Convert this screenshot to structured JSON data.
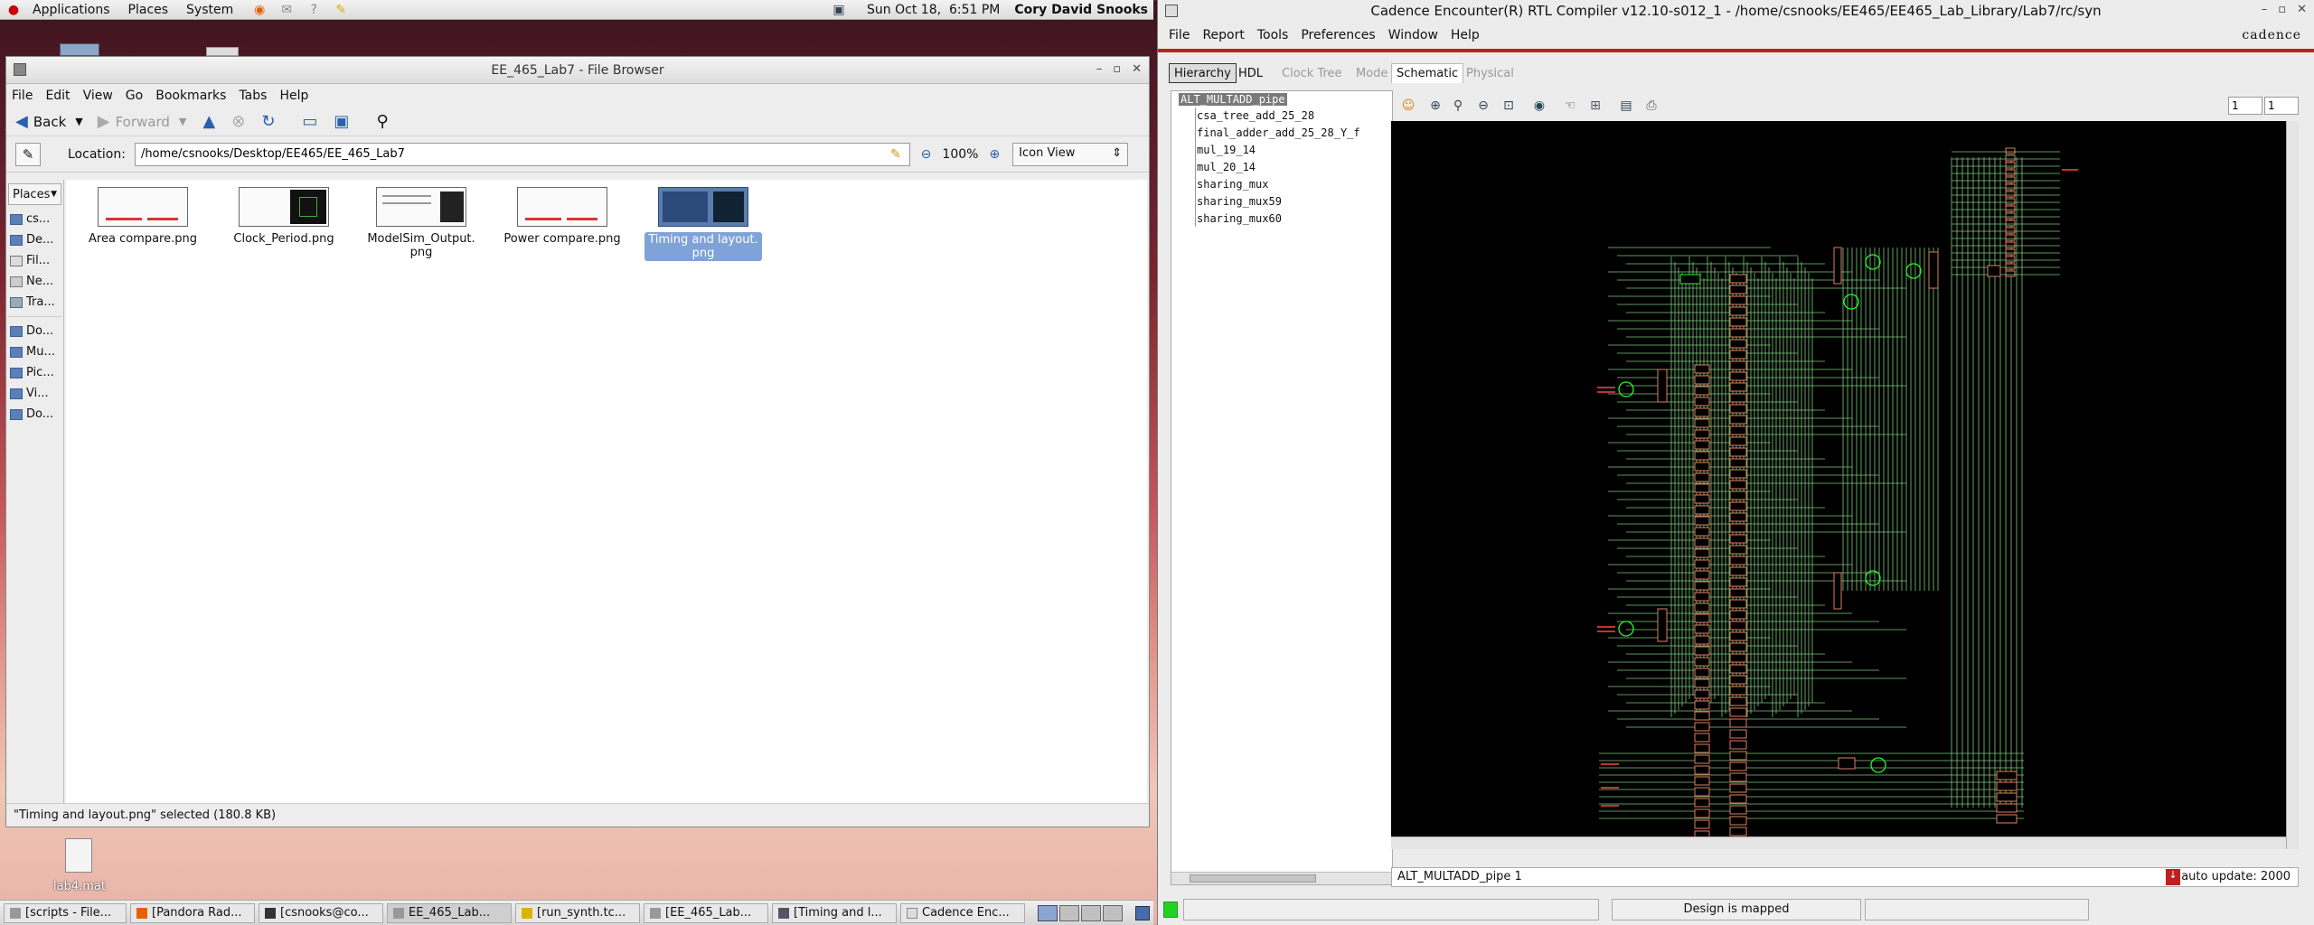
{
  "top_panel": {
    "menus": [
      "Applications",
      "Places",
      "System"
    ],
    "datetime": "Sun Oct 18,  6:51 PM",
    "user": "Cory David Snooks"
  },
  "desktop": {
    "file_label": "lab4.mat"
  },
  "file_browser": {
    "title": "EE_465_Lab7 - File Browser",
    "menu": [
      "File",
      "Edit",
      "View",
      "Go",
      "Bookmarks",
      "Tabs",
      "Help"
    ],
    "back_label": "Back",
    "forward_label": "Forward",
    "location_label": "Location:",
    "location_value": "/home/csnooks/Desktop/EE465/EE_465_Lab7",
    "zoom": "100%",
    "view_mode": "Icon View",
    "places_header": "Places",
    "places": [
      "cs...",
      "De...",
      "Fil...",
      "Ne...",
      "Tra...",
      "Do...",
      "Mu...",
      "Pic...",
      "Vi...",
      "Do..."
    ],
    "files": [
      {
        "name": "Area compare.png"
      },
      {
        "name": "Clock_Period.png"
      },
      {
        "name": "ModelSim_Output.\npng"
      },
      {
        "name": "Power compare.png"
      },
      {
        "name": "Timing and layout.\npng"
      }
    ],
    "status": "\"Timing and layout.png\" selected (180.8 KB)"
  },
  "cadence": {
    "title": "Cadence Encounter(R) RTL Compiler v12.10-s012_1 - /home/csnooks/EE465/EE465_Lab_Library/Lab7/rc/syn",
    "menu": [
      "File",
      "Report",
      "Tools",
      "Preferences",
      "Window",
      "Help"
    ],
    "logo": "cadence",
    "tabs": [
      "Hierarchy",
      "HDL",
      "Clock Tree",
      "Mode",
      "Schematic",
      "Physical"
    ],
    "tree": [
      "ALT_MULTADD_pipe",
      "csa_tree_add_25_28",
      "final_adder_add_25_28_Y_f",
      "mul_19_14",
      "mul_20_14",
      "sharing_mux",
      "sharing_mux59",
      "sharing_mux60"
    ],
    "page_fields": [
      "1",
      "1"
    ],
    "schematic_status": "ALT_MULTADD_pipe 1",
    "auto_update": "auto update: 2000",
    "design_status": "Design is mapped"
  },
  "taskbar": {
    "items": [
      "[scripts - File...",
      "[Pandora Rad...",
      "[csnooks@co...",
      "EE_465_Lab...",
      "[run_synth.tc...",
      "[EE_465_Lab...",
      "[Timing and l...",
      "Cadence Enc..."
    ]
  },
  "colors": {
    "accent_red": "#c02020",
    "selection": "#7fa3d8",
    "schematic_green": "#7cc97c",
    "cell_orange": "#e08060"
  }
}
